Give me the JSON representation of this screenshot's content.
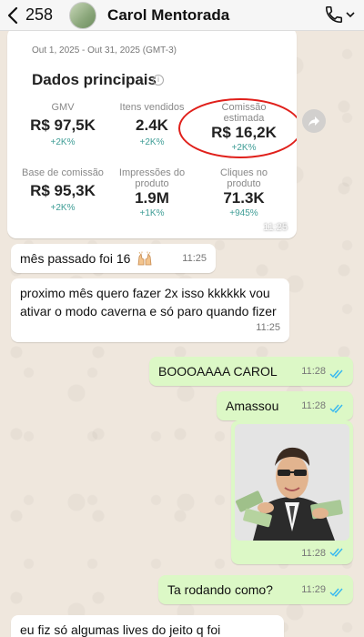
{
  "header": {
    "back_count": "258",
    "contact_name": "Carol Mentorada"
  },
  "screenshot_message": {
    "date_range": "Out 1, 2025 - Out 31, 2025 (GMT-3)",
    "section_title": "Dados principais",
    "info_icon_text": "i",
    "metrics": [
      {
        "label": "GMV",
        "value": "R$ 97,5K",
        "delta": "+2K%"
      },
      {
        "label": "Itens vendidos",
        "value": "2.4K",
        "delta": "+2K%"
      },
      {
        "label": "Comissão estimada",
        "value": "R$ 16,2K",
        "delta": "+2K%"
      },
      {
        "label": "Base de comissão",
        "value": "R$ 95,3K",
        "delta": "+2K%"
      },
      {
        "label": "Impressões do produto",
        "value": "1.9M",
        "delta": "+1K%"
      },
      {
        "label": "Cliques no produto",
        "value": "71.3K",
        "delta": "+945%"
      }
    ],
    "time": "11:25"
  },
  "messages": [
    {
      "direction": "in",
      "text": "mês passado foi 16",
      "time": "11:25"
    },
    {
      "direction": "in",
      "text": "proximo mês quero fazer 2x isso kkkkkk vou ativar o modo caverna e só paro quando fizer",
      "time": "11:25"
    },
    {
      "direction": "out",
      "text": "BOOOAAAA CAROL",
      "time": "11:28"
    },
    {
      "direction": "out",
      "text": "Amassou",
      "time": "11:28"
    },
    {
      "direction": "out",
      "text": "",
      "time": "11:28"
    },
    {
      "direction": "out",
      "text": "Ta rodando como?",
      "time": "11:29"
    },
    {
      "direction": "in",
      "text": "eu fiz só algumas lives do jeito q foi",
      "time": ""
    }
  ],
  "colors": {
    "outgoing_bubble": "#dcf8c6",
    "incoming_bubble": "#ffffff",
    "read_ticks": "#34b7f1",
    "highlight_circle": "#e0201b",
    "delta_text": "#3f9d96"
  },
  "icons": {
    "back": "chevron-left-icon",
    "call": "phone-icon",
    "forward": "forward-arrow-icon",
    "read": "double-check-icon",
    "emoji": "raised-hands-emoji"
  }
}
